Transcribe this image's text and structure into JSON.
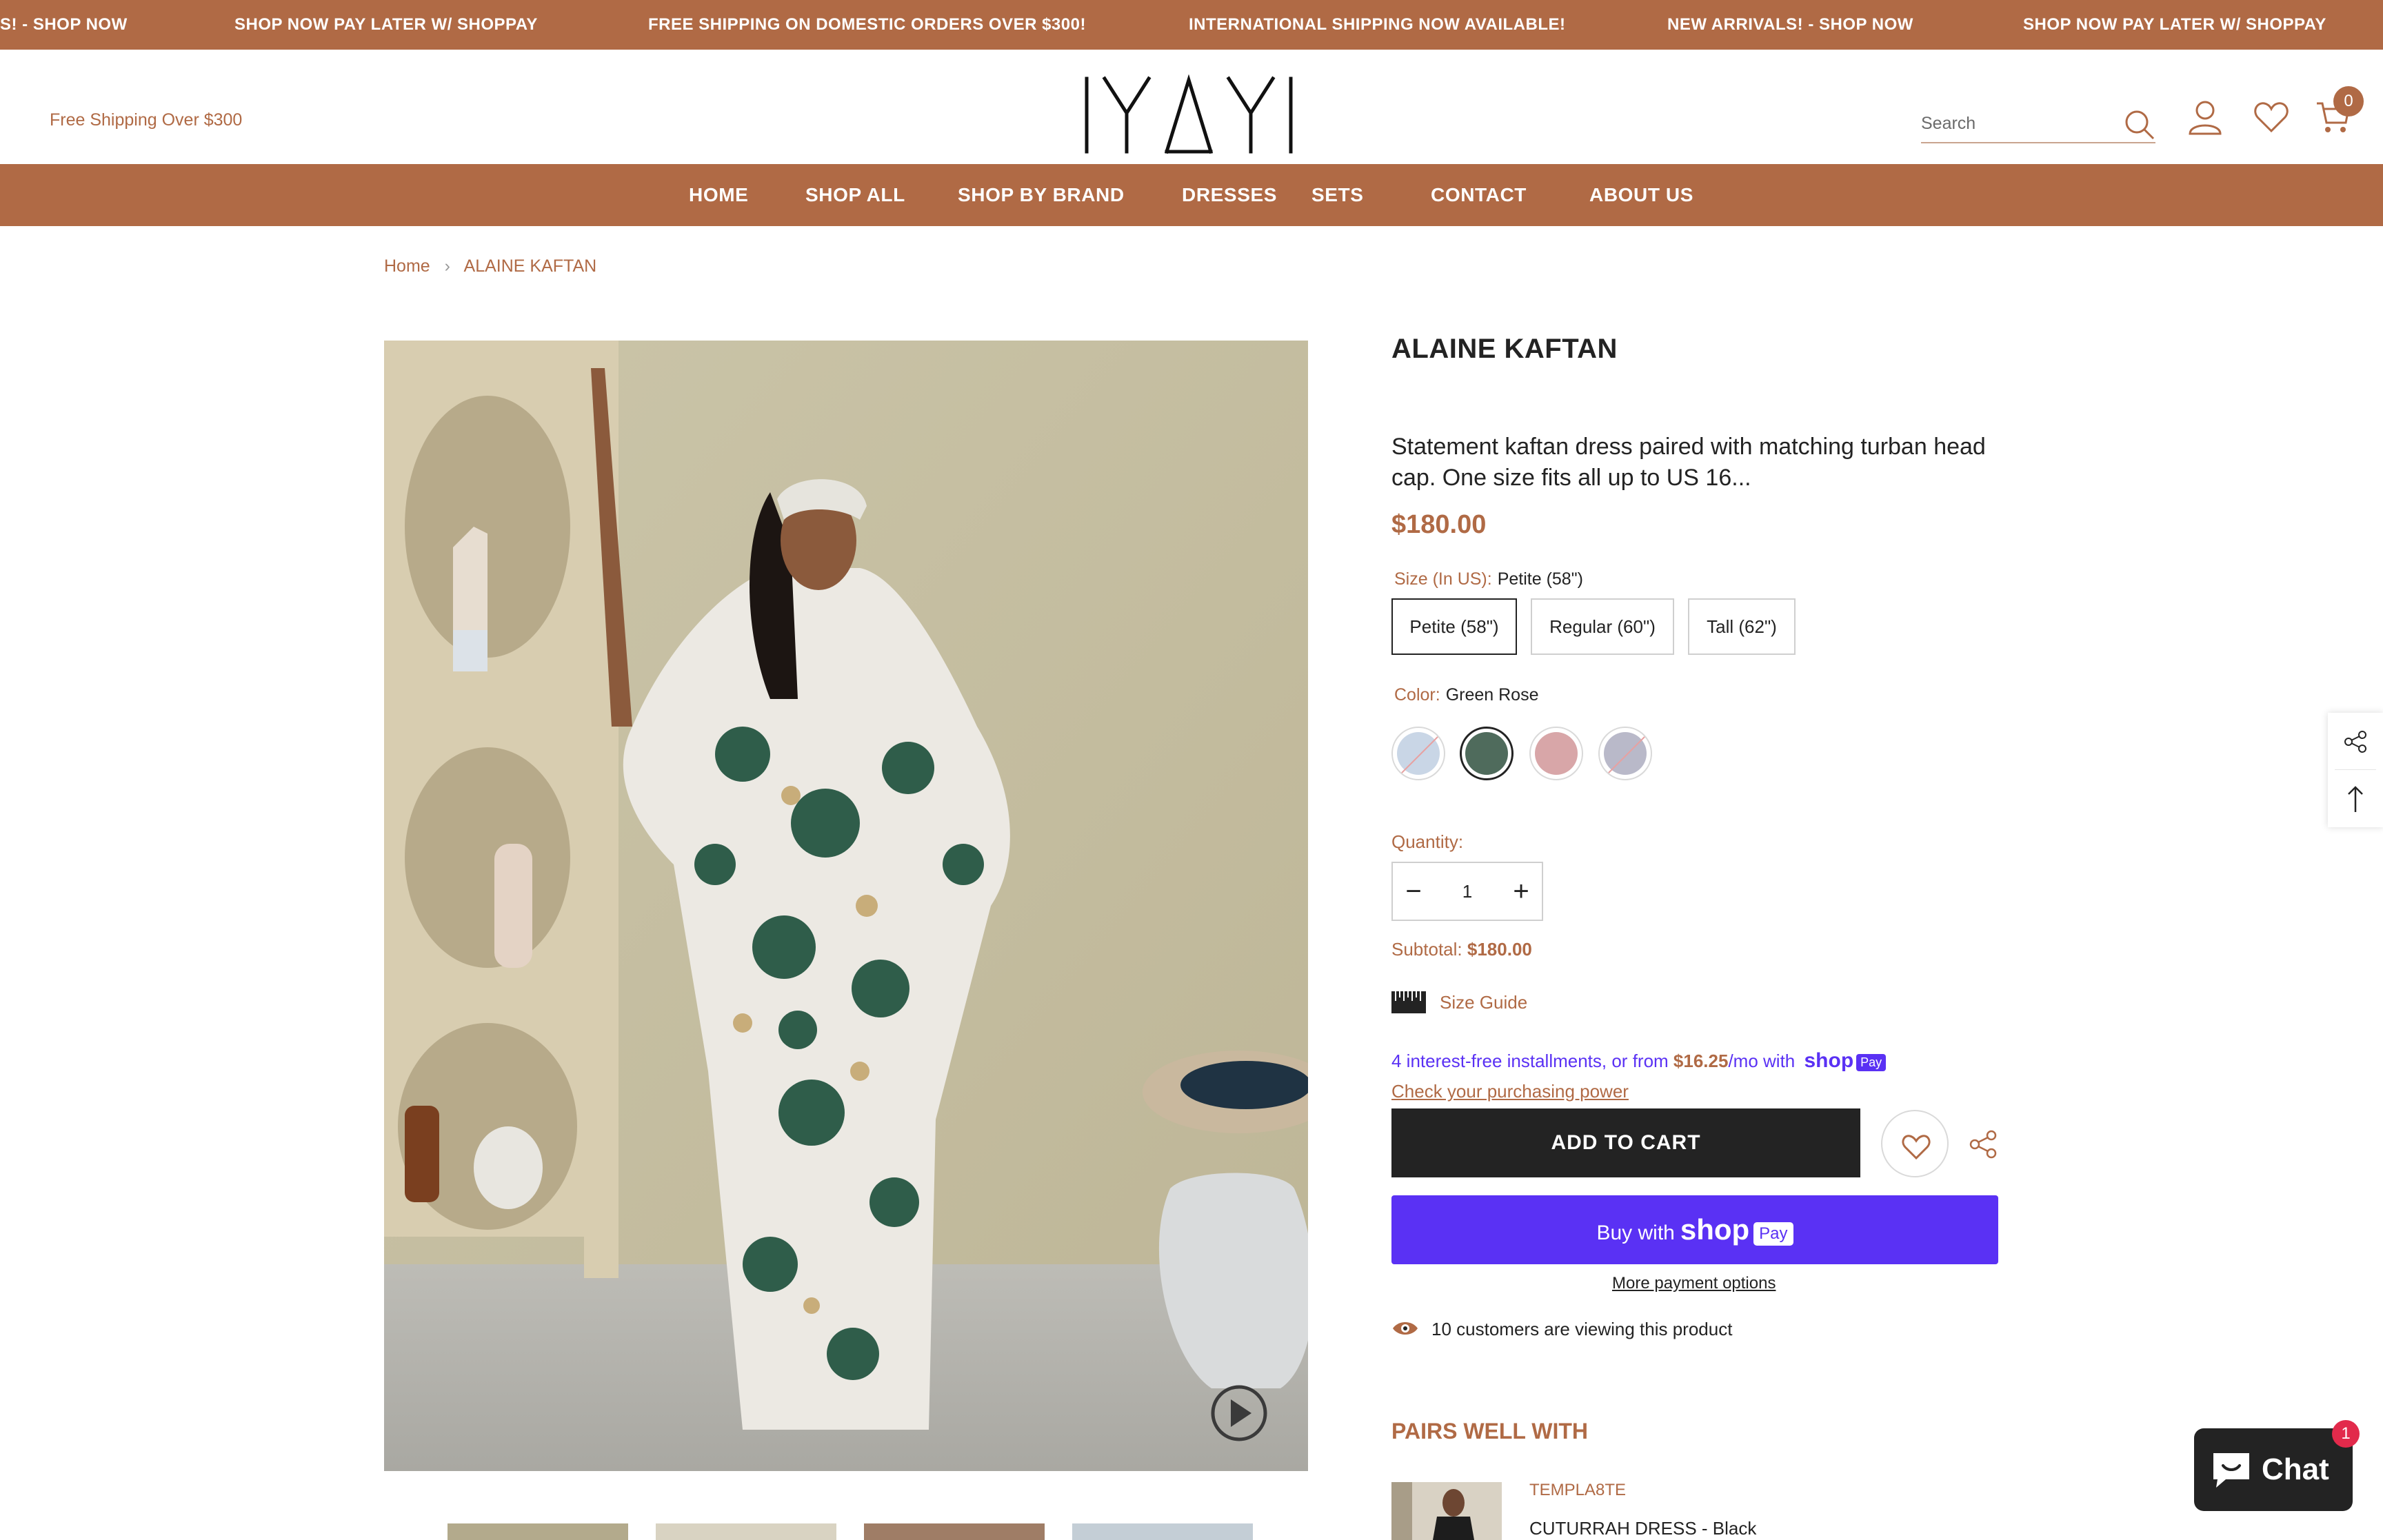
{
  "announcement": {
    "items": [
      "S! - SHOP NOW",
      "SHOP NOW PAY LATER W/ SHOPPAY",
      "FREE SHIPPING ON DOMESTIC ORDERS OVER $300!",
      "INTERNATIONAL SHIPPING NOW AVAILABLE!",
      "NEW ARRIVALS! - SHOP NOW",
      "SHOP NOW PAY LATER W/ SHOPPAY"
    ]
  },
  "header": {
    "free_shipping": "Free Shipping Over $300",
    "search_placeholder": "Search",
    "cart_count": "0"
  },
  "nav": {
    "items": [
      "HOME",
      "SHOP ALL",
      "SHOP BY BRAND",
      "DRESSES",
      "SETS",
      "CONTACT",
      "ABOUT US"
    ]
  },
  "breadcrumb": {
    "home": "Home",
    "current": "ALAINE KAFTAN"
  },
  "product": {
    "title": "ALAINE KAFTAN",
    "description": "Statement kaftan dress paired with matching turban head cap. One size fits all up to US 16...",
    "price": "$180.00",
    "size_label": "Size (In US):",
    "size_selected": "Petite (58\")",
    "sizes": [
      "Petite (58\")",
      "Regular (60\")",
      "Tall (62\")"
    ],
    "color_label": "Color:",
    "color_selected": "Green Rose",
    "colors": [
      {
        "swatch": "#c9d6e6",
        "unavailable": true
      },
      {
        "swatch": "#4f6b5c",
        "unavailable": false
      },
      {
        "swatch": "#d8a6a8",
        "unavailable": false
      },
      {
        "swatch": "#b9b9c9",
        "unavailable": true
      }
    ],
    "quantity_label": "Quantity:",
    "quantity": "1",
    "subtotal_label": "Subtotal:",
    "subtotal": "$180.00",
    "size_guide": "Size Guide",
    "installments_prefix": "4 interest-free installments, or from ",
    "installments_amount": "$16.25",
    "installments_suffix": "/mo with ",
    "installments_shop": "shop",
    "installments_pay": "Pay",
    "check_power": "Check your purchasing power",
    "add_to_cart": "ADD TO CART",
    "buy_with": "Buy with",
    "buy_shop": "shop",
    "buy_pay": "Pay",
    "more_payment": "More payment options",
    "viewing": "10 customers are viewing this product"
  },
  "pairs": {
    "title": "PAIRS WELL WITH",
    "brand": "TEMPLA8TE",
    "name": "CUTURRAH DRESS - Black"
  },
  "chat": {
    "label": "Chat",
    "badge": "1"
  },
  "colors": {
    "brand": "#b06a45",
    "dark": "#232323",
    "shoppay": "#5a31f4"
  }
}
